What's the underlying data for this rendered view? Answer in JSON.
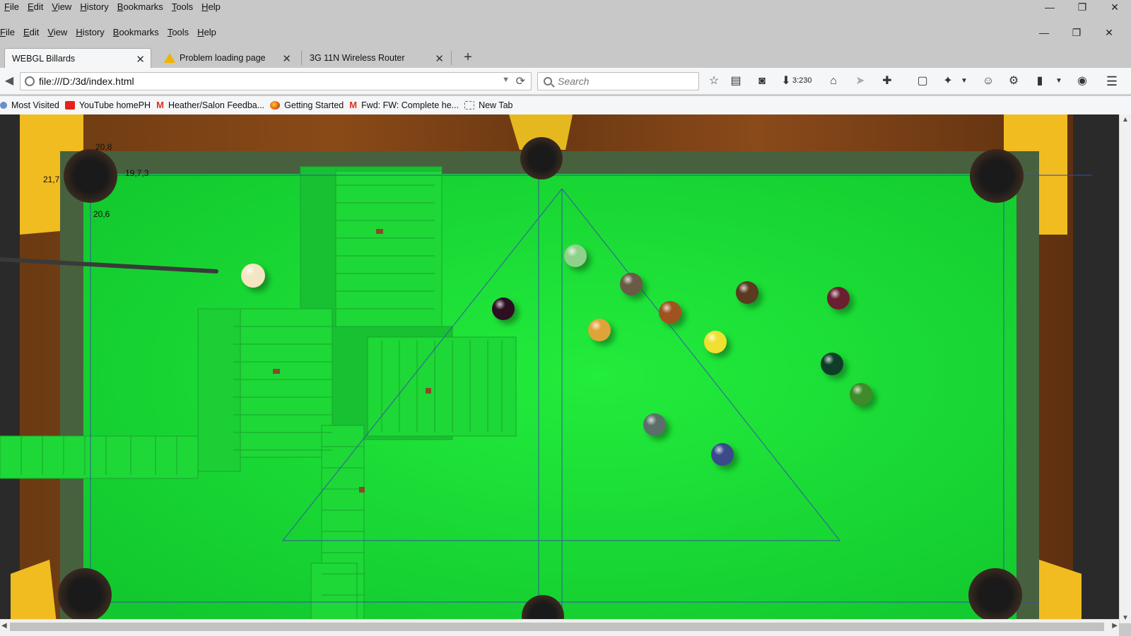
{
  "outer_menu": [
    "File",
    "Edit",
    "View",
    "History",
    "Bookmarks",
    "Tools",
    "Help"
  ],
  "inner_menu": [
    "File",
    "Edit",
    "View",
    "History",
    "Bookmarks",
    "Tools",
    "Help"
  ],
  "window_controls": {
    "minimize": "—",
    "restore": "❐",
    "close": "✕"
  },
  "tabs": [
    {
      "label": "WEBGL Billards",
      "active": true
    },
    {
      "label": "Problem loading page",
      "icon": "warning-icon"
    },
    {
      "label": "3G 11N Wireless Router"
    }
  ],
  "new_tab_label": "+",
  "navbar": {
    "url": "file:///D:/3d/index.html",
    "search_placeholder": "Search",
    "download_count": "3:230"
  },
  "bookmarks": [
    {
      "label": "Most Visited",
      "icon": "most-visited-icon"
    },
    {
      "label": "YouTube homePH",
      "icon": "youtube-icon"
    },
    {
      "label": "Heather/Salon Feedba...",
      "icon": "gmail-icon"
    },
    {
      "label": "Getting Started",
      "icon": "firefox-icon"
    },
    {
      "label": "Fwd: FW: Complete he...",
      "icon": "gmail-icon"
    },
    {
      "label": "New Tab",
      "icon": "blank-page-icon"
    }
  ],
  "game": {
    "debug_labels": [
      "20,8",
      "21,7",
      "19,7,3",
      "20,6"
    ],
    "balls": [
      {
        "color": "#f4e6c2",
        "type": "cue"
      },
      {
        "color": "#8fd18a"
      },
      {
        "color": "#6b5a45"
      },
      {
        "color": "#2d0f22"
      },
      {
        "color": "#a0531f"
      },
      {
        "color": "#e0a33a"
      },
      {
        "color": "#f0e030"
      },
      {
        "color": "#5a3a20"
      },
      {
        "color": "#6a2030"
      },
      {
        "color": "#0f3d28"
      },
      {
        "color": "#3f8a2a"
      },
      {
        "color": "#5c6e6a"
      },
      {
        "color": "#3a4a8a"
      }
    ],
    "colors": {
      "felt": "#1ee53a",
      "rail": "#5b3a1a",
      "corner": "#f4c022"
    }
  }
}
